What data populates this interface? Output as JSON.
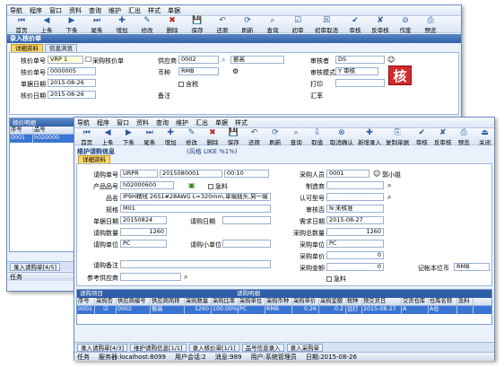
{
  "back": {
    "menu": [
      "导航",
      "程序",
      "窗口",
      "资料",
      "查询",
      "维护",
      "汇出",
      "样式",
      "单据"
    ],
    "toolbar": [
      "首页",
      "上条",
      "下条",
      "尾条",
      "增加",
      "修改",
      "删除",
      "保存",
      "还原",
      "刷新",
      "查询",
      "初审",
      "初审取消",
      "审核",
      "反审核",
      "作废",
      "预览"
    ],
    "title": "录入核价单",
    "tabs": [
      "详细资料",
      "信息浏览"
    ],
    "labels": {
      "no": "核价单号",
      "purchase_no": "采购核价单",
      "supplier": "供应商",
      "approver": "审核者",
      "order_no": "核价单号",
      "currency": "币种",
      "audit_mode": "审核模式",
      "date": "单据日期",
      "print": "打印",
      "price_date": "核价日期",
      "remark": "备注",
      "rate": "汇率",
      "tax": "含税"
    },
    "values": {
      "no": "VRP 1",
      "order_no": "0000005",
      "supplier": "0002",
      "supplier_name": "振高",
      "approver": "DS",
      "currency": "RMB",
      "audit_mode": "Y 审核",
      "date": "2015-08-26",
      "price_date": "2015-08-26"
    },
    "seal": "核",
    "list_title": "核价明细",
    "list_head": [
      "序号",
      "品号"
    ],
    "list_row": [
      "0001",
      "h020000"
    ],
    "wtab": "录入请购单[4/5]",
    "status": [
      "任务"
    ]
  },
  "front": {
    "menu": [
      "导航",
      "程序",
      "窗口",
      "资料",
      "查询",
      "维护",
      "汇出",
      "单据",
      "样式"
    ],
    "toolbar": [
      "首页",
      "上条",
      "下条",
      "尾条",
      "增加",
      "修改",
      "删除",
      "保存",
      "还原",
      "刷新",
      "查询",
      "取值",
      "取消确认",
      "新增录入",
      "复制单据",
      "审核",
      "反审核",
      "预览",
      "关闭"
    ],
    "title": "维护请购信息",
    "filter": "(风格 LIKE %1%)",
    "tabs": [
      "详细资料"
    ],
    "labels": {
      "req_no": "请购单号",
      "item_no": "产品品号",
      "name": "品名",
      "spec": "规格",
      "date": "单据日期",
      "req_qty": "请购数量",
      "req_unit": "请购单位",
      "req_remark": "请购备注",
      "ref_supplier": "参考供应商",
      "delivery": "请购日期",
      "small_unit": "请购小单位",
      "buyer": "采购人员",
      "maker": "制造商",
      "model": "认可型号",
      "audit": "审核否",
      "need_date": "需求日期",
      "purchase_qty": "采购总数量",
      "purchase_unit": "采购单位",
      "purchase_price": "采购单价",
      "purchase_amt": "采购金额",
      "record_unit": "记帐本位币"
    },
    "values": {
      "req_no": "URPR",
      "req_no2": "2015080001",
      "req_no3": "00:10",
      "item_no": "h02000600",
      "urgent": "急料",
      "name": "IP9H精线 26S1#28AWG L=320mm,单端插头,另一端",
      "spec": "M01",
      "date": "20150824",
      "req_qty": "1260",
      "req_unit": "PC",
      "buyer": "0001",
      "buyer_name": "郭小姐",
      "audit": "N:未核准",
      "need_date": "2015-08-27",
      "purchase_qty": "1260",
      "purchase_unit": "PC",
      "purchase_price": "0",
      "purchase_amt": "0",
      "urgent2": "急料",
      "record_unit": "RMB"
    },
    "grid_label": "请购明细",
    "grid_group": "请购项目",
    "grid_head": [
      "序号",
      "采购否",
      "供应商编号",
      "供应商简称",
      "采购数量",
      "采购比率",
      "采购单位",
      "采购币种",
      "采购单价",
      "采购金额",
      "税种",
      "预交货日",
      "交货仓库",
      "仓库名称",
      "急料"
    ],
    "grid_row": [
      "0001",
      "☑",
      "0002",
      "振高",
      "1260",
      "100.00%",
      "PC",
      "RMB",
      "0.26",
      "0.2",
      "远打",
      "2015-08-27",
      "A",
      "A仓",
      ""
    ],
    "wtabs": [
      "录入请购单[4/3]",
      "维护请购信息[1/1]",
      "录入核价单[1/1]",
      "品号信息录入",
      "录入采购单"
    ],
    "status": [
      "任务",
      "服务器:localhost:8099",
      "用户会话:2",
      "消息:989",
      "用户:系统管理员",
      "日期:2015-08-26"
    ]
  }
}
